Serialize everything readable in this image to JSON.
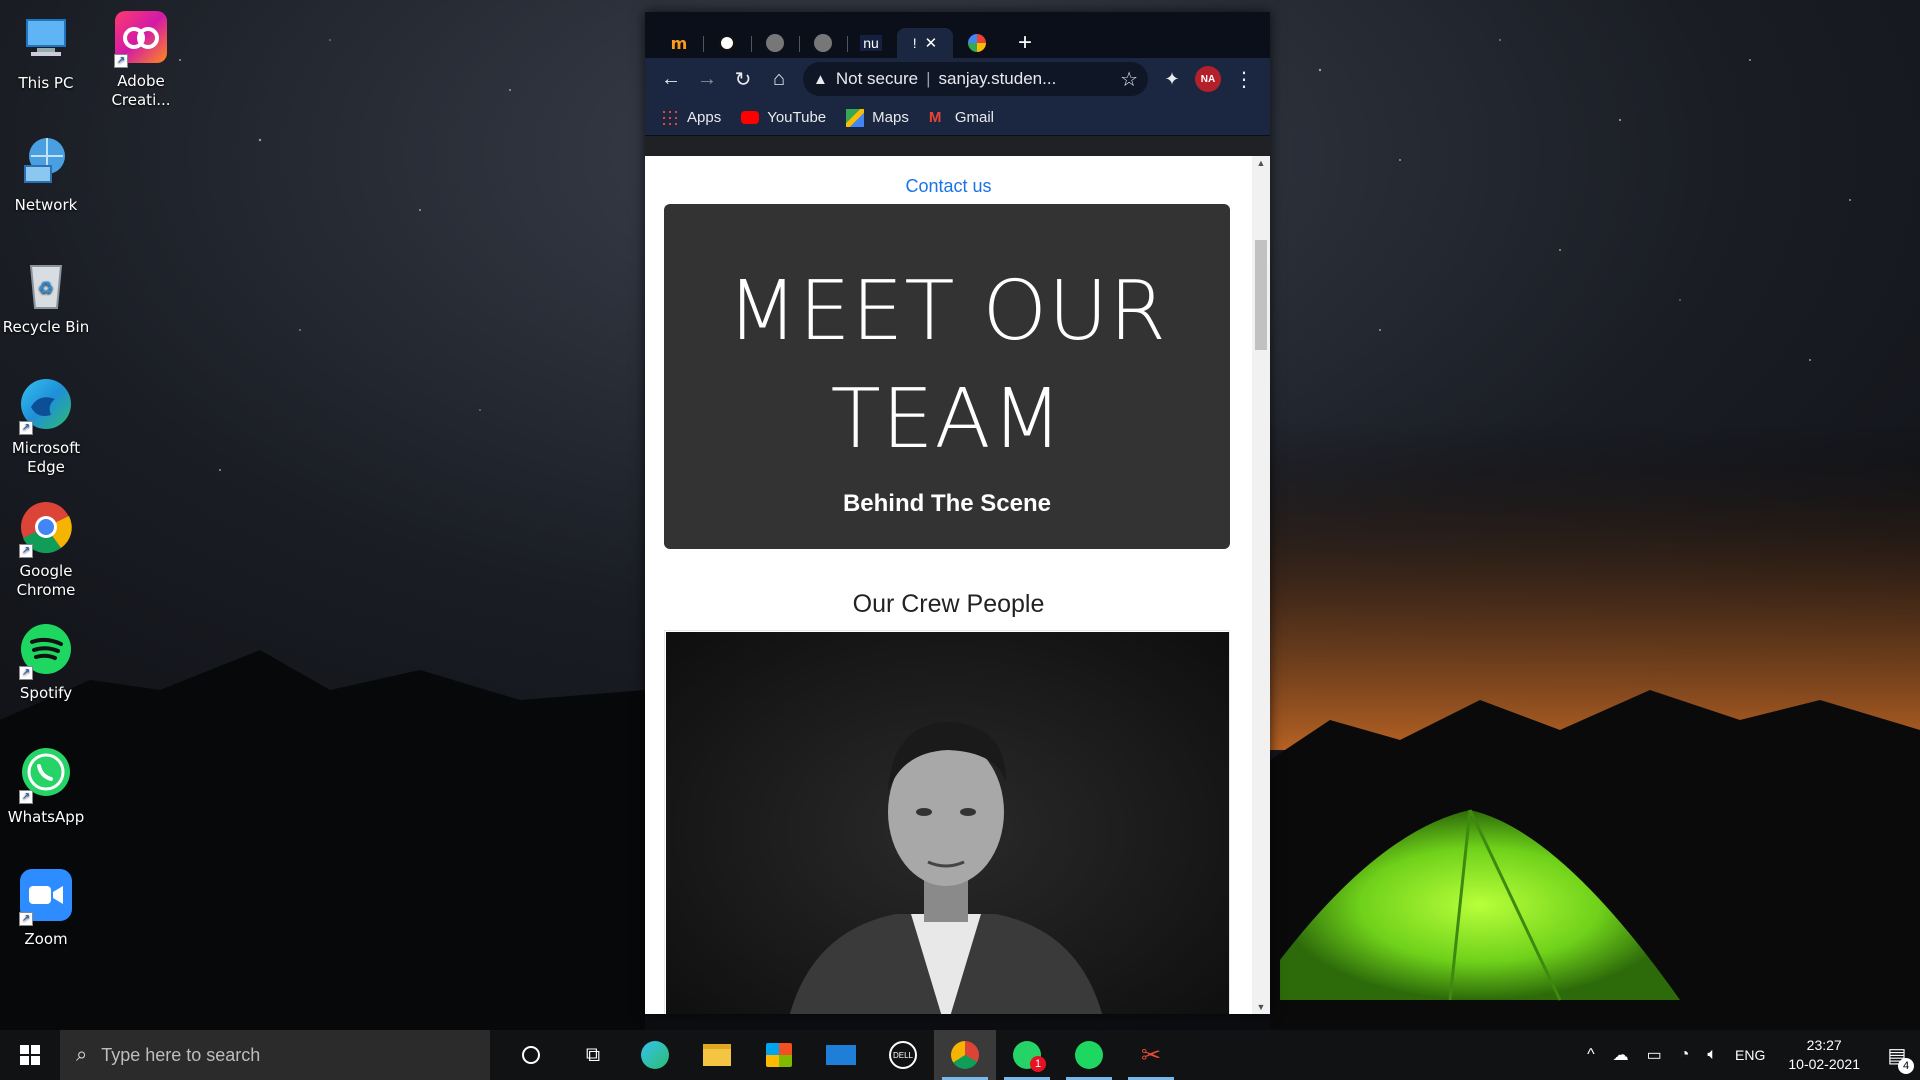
{
  "desktop": {
    "icons": [
      {
        "label": "This PC"
      },
      {
        "label": "Adobe Creati..."
      },
      {
        "label": "Network"
      },
      {
        "label": "Recycle Bin"
      },
      {
        "label": "Microsoft Edge"
      },
      {
        "label": "Google Chrome"
      },
      {
        "label": "Spotify"
      },
      {
        "label": "WhatsApp"
      },
      {
        "label": "Zoom"
      }
    ]
  },
  "browser": {
    "tabs": [
      {
        "icon": "m-favicon"
      },
      {
        "icon": "globe-favicon"
      },
      {
        "icon": "globe-favicon"
      },
      {
        "icon": "globe-favicon"
      },
      {
        "icon": "nu-favicon",
        "text": "nu"
      },
      {
        "icon": "active-tab",
        "text": "!"
      },
      {
        "icon": "google-favicon"
      }
    ],
    "new_tab": "+",
    "close_tab": "✕",
    "address": {
      "security": "Not secure",
      "url": "sanjay.studen..."
    },
    "bookmarks": [
      {
        "label": "Apps"
      },
      {
        "label": "YouTube"
      },
      {
        "label": "Maps"
      },
      {
        "label": "Gmail"
      }
    ],
    "profile_text": "NA"
  },
  "page": {
    "contact_link": "Contact us",
    "hero_title": "MEET OUR TEAM",
    "hero_subtitle": "Behind The Scene",
    "crew_title": "Our Crew People"
  },
  "taskbar": {
    "search_placeholder": "Type here to search",
    "whatsapp_badge": "1",
    "language": "ENG",
    "time": "23:27",
    "date": "10-02-2021",
    "notification_count": "4"
  },
  "colors": {
    "link": "#1a73e8",
    "hero_bg": "#333333",
    "browser_frame": "#1b2740",
    "taskbar": "#111214",
    "tent_green": "#7fe81a"
  }
}
